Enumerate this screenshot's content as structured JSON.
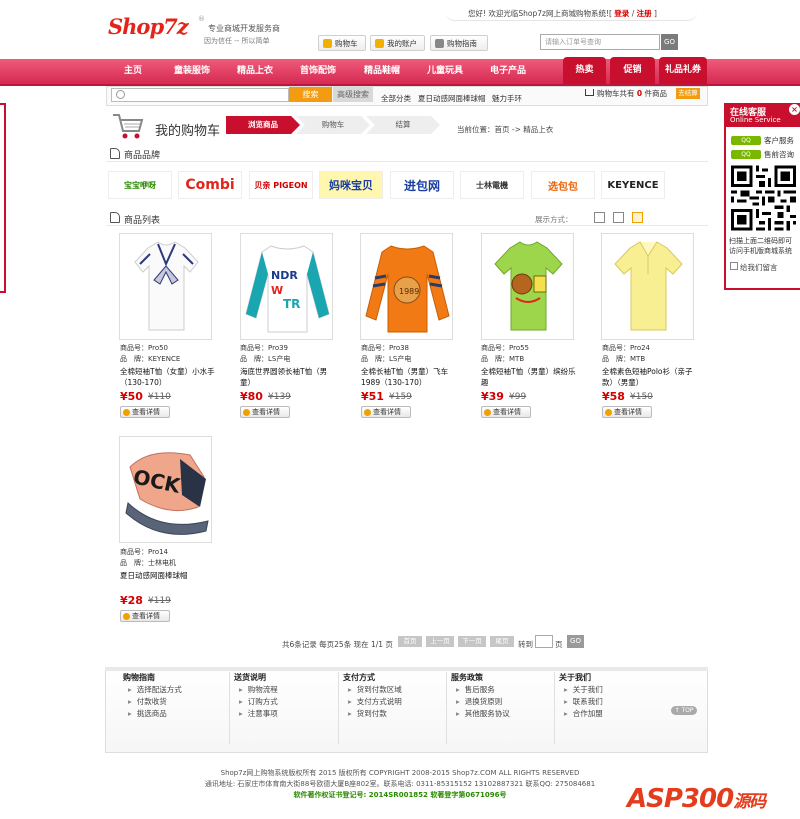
{
  "header": {
    "logo_text": "Shop7z",
    "logo_reg": "®",
    "slogan1": "专业商城开发服务商",
    "slogan2": "因为信任 -- 所以简单",
    "welcome": "您好! 欢迎光临Shop7z网上商城购物系统!",
    "login": "登录",
    "sep": "/",
    "register": "注册",
    "bracket_l": "[",
    "bracket_r": "]",
    "btn_cart": "购物车",
    "btn_account": "我的账户",
    "btn_guide": "购物指南",
    "order_placeholder": "请输入订单号查询",
    "order_go": "GO"
  },
  "nav": {
    "items": [
      "主页",
      "童装服饰",
      "精品上衣",
      "首饰配饰",
      "精品鞋帽",
      "儿童玩具",
      "电子产品"
    ],
    "hot": [
      "热卖",
      "促销",
      "礼品礼券"
    ]
  },
  "search": {
    "button": "搜索",
    "advanced": "高级搜索",
    "hot_words": [
      "全部分类",
      "夏日动感网面棒球帽",
      "魅力手环"
    ],
    "cart_prefix": "购物车共有",
    "cart_count": "0",
    "cart_suffix": "件商品",
    "checkout": "去结算"
  },
  "cart_page": {
    "title": "我的购物车",
    "steps": [
      "浏览商品",
      "购物车",
      "结算"
    ],
    "location": "当前位置：首页 -> 精品上衣"
  },
  "brands": {
    "title": "商品品牌",
    "items": [
      "宝宝咿呀",
      "Combi",
      "贝亲 PIGEON",
      "妈咪宝贝",
      "进包网",
      "士林電機",
      "选包包",
      "KEYENCE"
    ]
  },
  "products": {
    "title": "商品列表",
    "view_mode_label": "展示方式：",
    "id_label": "商品号：",
    "brand_label": "品　牌：",
    "detail_label": "查看详情",
    "items": [
      {
        "id": "Pro50",
        "brand": "KEYENCE",
        "name": "全棉短袖T恤（女童）小水手（130-170）",
        "price": "¥50",
        "old_price": "¥110"
      },
      {
        "id": "Pro39",
        "brand": "LS产电",
        "name": "海底世界圆领长袖T恤（男童）",
        "price": "¥80",
        "old_price": "¥139"
      },
      {
        "id": "Pro38",
        "brand": "LS产电",
        "name": "全棉长袖T恤（男童）飞车1989（130-170）",
        "price": "¥51",
        "old_price": "¥159"
      },
      {
        "id": "Pro55",
        "brand": "MTB",
        "name": "全棉短袖T恤（男童）缤纷乐趣",
        "price": "¥39",
        "old_price": "¥99"
      },
      {
        "id": "Pro24",
        "brand": "MTB",
        "name": "全棉素色短袖Polo衫（亲子款）（男童）",
        "price": "¥58",
        "old_price": "¥150"
      },
      {
        "id": "Pro14",
        "brand": "士林电机",
        "name": "夏日动感网面棒球帽",
        "price": "¥28",
        "old_price": "¥119"
      }
    ]
  },
  "pager": {
    "summary": "共6条记录 每页25条 现在 1/1 页",
    "first": "首页",
    "prev": "上一页",
    "next": "下一页",
    "last": "尾页",
    "goto": "转到",
    "page_unit": "页",
    "go": "GO"
  },
  "footer": {
    "columns": [
      {
        "title": "购物指南",
        "links": [
          "选择配送方式",
          "付款收货",
          "挑选商品"
        ]
      },
      {
        "title": "送货说明",
        "links": [
          "购物流程",
          "订购方式",
          "注意事项"
        ]
      },
      {
        "title": "支付方式",
        "links": [
          "货到付款区域",
          "支付方式说明",
          "货到付款"
        ]
      },
      {
        "title": "服务政策",
        "links": [
          "售后服务",
          "退换货原则",
          "其他服务协议"
        ]
      },
      {
        "title": "关于我们",
        "links": [
          "关于我们",
          "联系我们",
          "合作加盟"
        ]
      }
    ],
    "top": "TOP",
    "copyright": "Shop7z网上购物系统版权所有 2015 版权所有 COPYRIGHT 2008-2015 Shop7z.COM ALL RIGHTS RESERVED",
    "address": "通讯地址: 石家庄市体育南大街88号欧德大厦B座802室。联系电话: 0311-85315152 13102887321 联系QQ: 275084681",
    "cert": "软件著作权证书登记号: 2014SR001852  软著登字第0671096号"
  },
  "service": {
    "title": "在线客服",
    "subtitle": "Online Service",
    "close": "×",
    "qq_label": "QQ",
    "rows": [
      "客户服务",
      "售前咨询"
    ],
    "note1": "扫描上面二维码即可",
    "note2": "访问手机版商城系统",
    "message": "给我们留言"
  },
  "watermark": {
    "latin": "ASP300",
    "cn": "源码"
  },
  "colors": {
    "brand_red": "#c8102e",
    "nav_pink": "#e23b63",
    "orange": "#f39c12",
    "price_red": "#d40000",
    "qq_green": "#7ab800"
  }
}
